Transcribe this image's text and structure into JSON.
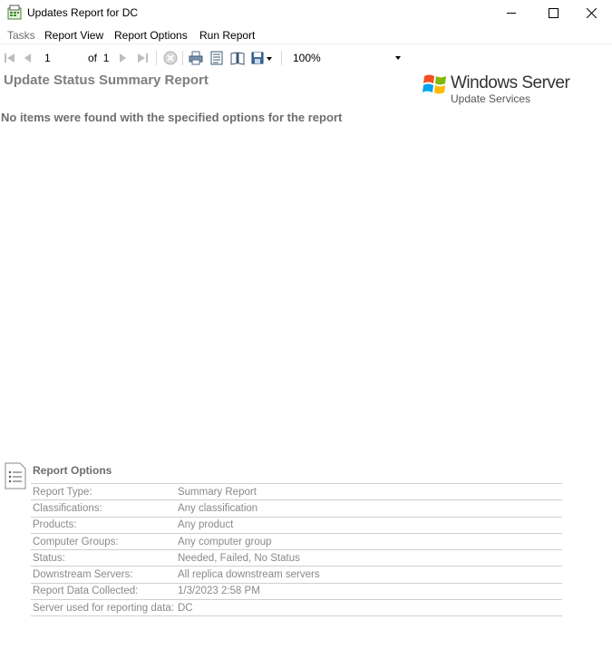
{
  "window": {
    "title": "Updates Report for DC",
    "controls": [
      "minimize",
      "maximize",
      "close"
    ]
  },
  "menu": [
    {
      "label": "Tasks",
      "enabled": false
    },
    {
      "label": "Report View",
      "enabled": true
    },
    {
      "label": "Report Options",
      "enabled": true
    },
    {
      "label": "Run Report",
      "enabled": true
    }
  ],
  "toolbar": {
    "page_value": "1",
    "of_label": "of",
    "page_total": "1",
    "zoom_value": "100%",
    "icons": [
      "first-page-icon",
      "previous-page-icon",
      "next-page-icon",
      "last-page-icon",
      "stop-icon",
      "print-icon",
      "print-layout-icon",
      "page-setup-icon",
      "export-icon"
    ]
  },
  "report": {
    "title": "Update Status Summary Report",
    "message": "No items were found with the specified options for the report",
    "logo": {
      "main": "Windows Server",
      "sub": "Update Services"
    }
  },
  "options": {
    "title": "Report Options",
    "rows": [
      {
        "label": "Report Type:",
        "value": "Summary Report"
      },
      {
        "label": "Classifications:",
        "value": "Any classification"
      },
      {
        "label": "Products:",
        "value": "Any product"
      },
      {
        "label": "Computer Groups:",
        "value": "Any computer group"
      },
      {
        "label": "Status:",
        "value": "Needed, Failed, No Status"
      },
      {
        "label": "Downstream Servers:",
        "value": "All replica downstream servers"
      },
      {
        "label": "Report Data Collected:",
        "value": "1/3/2023 2:58 PM"
      },
      {
        "label": "Server used for reporting data:",
        "value": "DC"
      }
    ]
  },
  "colors": {
    "logo_red": "#f25022",
    "logo_green": "#7fba00",
    "logo_blue": "#00a4ef",
    "logo_yellow": "#ffb900",
    "muted_text": "#7f7f7f"
  }
}
